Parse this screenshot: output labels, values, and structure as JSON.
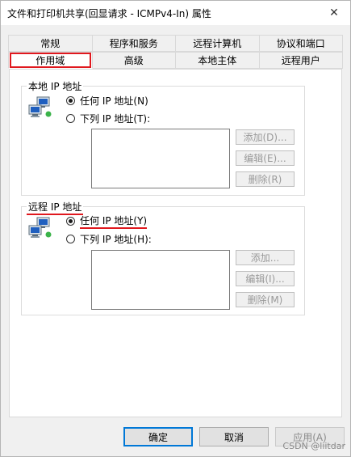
{
  "window": {
    "title": "文件和打印机共享(回显请求 - ICMPv4-In) 属性",
    "close_symbol": "✕"
  },
  "tabs": {
    "row1": [
      {
        "label": "常规"
      },
      {
        "label": "程序和服务"
      },
      {
        "label": "远程计算机"
      },
      {
        "label": "协议和端口"
      }
    ],
    "row2": [
      {
        "label": "作用域",
        "active": true
      },
      {
        "label": "高级"
      },
      {
        "label": "本地主体"
      },
      {
        "label": "远程用户"
      }
    ]
  },
  "local_ip": {
    "title": "本地 IP 地址",
    "icon": "network-computers-icon",
    "option_any": "任何 IP 地址(N)",
    "option_list": "下列 IP 地址(T):",
    "selected": "any",
    "buttons": {
      "add": "添加(D)...",
      "edit": "编辑(E)...",
      "remove": "删除(R)"
    }
  },
  "remote_ip": {
    "title": "远程 IP 地址",
    "icon": "network-computers-icon",
    "option_any": "任何 IP 地址(Y)",
    "option_list": "下列 IP 地址(H):",
    "selected": "any",
    "buttons": {
      "add": "添加...",
      "edit": "编辑(I)...",
      "remove": "删除(M)"
    }
  },
  "footer": {
    "ok": "确定",
    "cancel": "取消",
    "apply": "应用(A)"
  },
  "watermark": "CSDN @liitdar",
  "colors": {
    "highlight_red": "#e0181e",
    "focus_blue": "#0078d7"
  }
}
